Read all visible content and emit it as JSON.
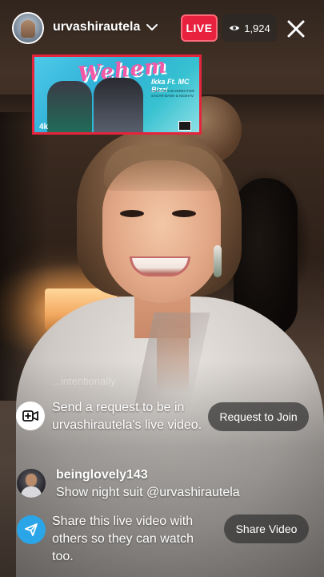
{
  "header": {
    "username": "urvashirautela",
    "live_label": "LIVE",
    "viewer_count": "1,924"
  },
  "poster": {
    "title": "Wehem",
    "artist": "Ikka Ft. MC Bizzi",
    "credits": "music: ZAYUS  DIRECTOR: SAGAR BAWA & KESHAV",
    "logo": "4k"
  },
  "comments": {
    "faded_text": "...intentionally",
    "request": {
      "text": "Send a request to be in urvashirautela's live video.",
      "button": "Request to Join"
    },
    "user_comment": {
      "author": "beinglovely143",
      "text": "Show night suit @urvashirautela"
    },
    "share": {
      "text": "Share this live video with others so they can watch too.",
      "button": "Share Video"
    }
  },
  "colors": {
    "live_red": "#e8213f",
    "share_blue": "#2aa6e8"
  }
}
